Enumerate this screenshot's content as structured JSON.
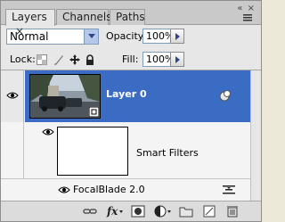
{
  "tabs": [
    {
      "label": "Layers",
      "active": true,
      "close": "×"
    },
    {
      "label": "Channels",
      "active": false
    },
    {
      "label": "Paths",
      "active": false
    }
  ],
  "window_buttons": "«  ×",
  "blend_mode": {
    "value": "Normal"
  },
  "opacity": {
    "label": "Opacity:",
    "value": "100%"
  },
  "lock": {
    "label": "Lock:"
  },
  "fill": {
    "label": "Fill:",
    "value": "100%"
  },
  "layers": [
    {
      "name": "Layer 0",
      "selected": true,
      "visible": true,
      "type": "smart-object"
    },
    {
      "name": "Smart Filters",
      "visible": true,
      "type": "smart-filters"
    },
    {
      "name": "FocalBlade 2.0",
      "visible": true,
      "type": "filter"
    }
  ],
  "toolbar_icons": [
    "link-icon",
    "fx-icon",
    "mask-icon",
    "adjustment-icon",
    "group-folder-icon",
    "new-layer-icon",
    "trash-icon"
  ],
  "colors": {
    "selection": "#3a6cc4",
    "panel": "#dcdcdc",
    "field_border": "#7f9db9"
  }
}
